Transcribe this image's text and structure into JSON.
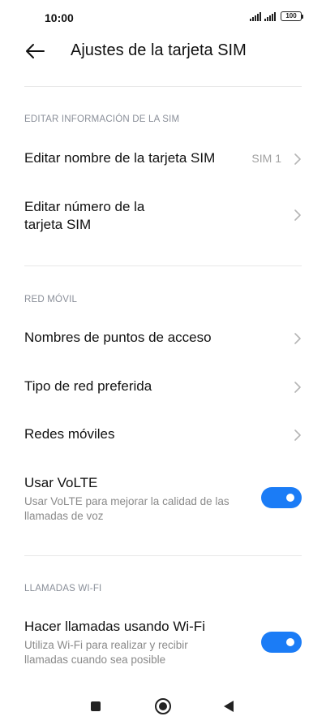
{
  "status_bar": {
    "time": "10:00",
    "battery": "100"
  },
  "header": {
    "title": "Ajustes de la tarjeta SIM"
  },
  "sections": {
    "sim_info": {
      "header": "EDITAR INFORMACIÓN DE LA SIM",
      "edit_name": {
        "title": "Editar nombre de la tarjeta SIM",
        "value": "SIM 1"
      },
      "edit_number": {
        "title_line1": "Editar número de la",
        "title_line2": "tarjeta SIM"
      }
    },
    "mobile_network": {
      "header": "RED MÓVIL",
      "apn": {
        "title": "Nombres de puntos de acceso"
      },
      "preferred_network": {
        "title": "Tipo de red preferida"
      },
      "mobile_networks": {
        "title": "Redes móviles"
      },
      "volte": {
        "title": "Usar VoLTE",
        "sub_line1": "Usar VoLTE para mejorar la calidad de las",
        "sub_line2": "llamadas de voz",
        "enabled": true
      }
    },
    "wifi_calls": {
      "header": "LLAMADAS WI-FI",
      "wifi_calling": {
        "title": "Hacer llamadas usando Wi-Fi",
        "sub_line1": "Utiliza Wi-Fi para realizar y recibir",
        "sub_line2": "llamadas cuando sea posible",
        "enabled": true
      }
    }
  },
  "colors": {
    "accent": "#1b7cf6",
    "section_header": "#8a8f99"
  }
}
